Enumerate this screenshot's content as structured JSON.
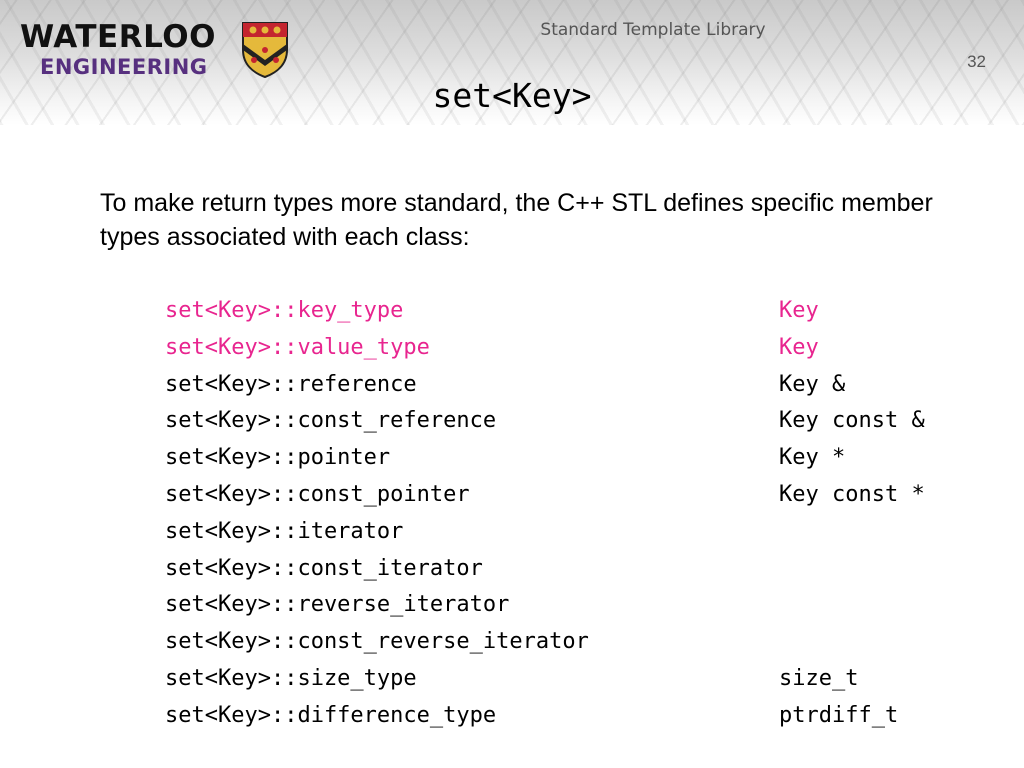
{
  "header": {
    "logo_line1": "WATERLOO",
    "logo_line2": "ENGINEERING",
    "title": "Standard Template Library",
    "slide_number": "32"
  },
  "slide": {
    "title": "set<Key>",
    "intro": "To make return types more standard, the C++ STL defines specific member types associated with each class:"
  },
  "colors": {
    "highlight": "#e8258f",
    "normal": "#000000",
    "logo_purple": "#57307f",
    "crest_red": "#c4252f",
    "crest_gold": "#e5b93b"
  },
  "member_types": [
    {
      "name": "set<Key>::key_type",
      "value": "Key",
      "highlight": true
    },
    {
      "name": "set<Key>::value_type",
      "value": "Key",
      "highlight": true
    },
    {
      "name": "set<Key>::reference",
      "value": "Key &",
      "highlight": false
    },
    {
      "name": "set<Key>::const_reference",
      "value": "Key const &",
      "highlight": false
    },
    {
      "name": "set<Key>::pointer",
      "value": "Key *",
      "highlight": false
    },
    {
      "name": "set<Key>::const_pointer",
      "value": "Key const *",
      "highlight": false
    },
    {
      "name": "set<Key>::iterator",
      "value": "",
      "highlight": false
    },
    {
      "name": "set<Key>::const_iterator",
      "value": "",
      "highlight": false
    },
    {
      "name": "set<Key>::reverse_iterator",
      "value": "",
      "highlight": false
    },
    {
      "name": "set<Key>::const_reverse_iterator",
      "value": "",
      "highlight": false
    },
    {
      "name": "set<Key>::size_type",
      "value": "size_t",
      "highlight": false
    },
    {
      "name": "set<Key>::difference_type",
      "value": "ptrdiff_t",
      "highlight": false
    }
  ]
}
